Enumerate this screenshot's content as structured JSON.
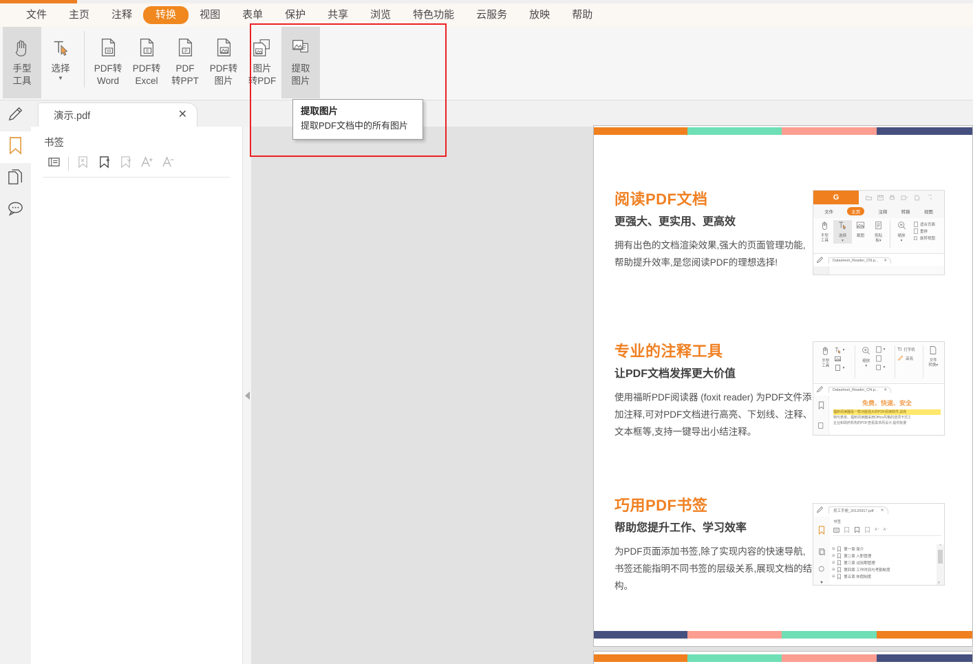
{
  "app": {
    "accent_orange": "#f0871f",
    "highlight_red": "#ec2024"
  },
  "menubar": {
    "items": [
      {
        "label": "文件",
        "active": false
      },
      {
        "label": "主页",
        "active": false
      },
      {
        "label": "注释",
        "active": false
      },
      {
        "label": "转换",
        "active": true
      },
      {
        "label": "视图",
        "active": false
      },
      {
        "label": "表单",
        "active": false
      },
      {
        "label": "保护",
        "active": false
      },
      {
        "label": "共享",
        "active": false
      },
      {
        "label": "浏览",
        "active": false
      },
      {
        "label": "特色功能",
        "active": false
      },
      {
        "label": "云服务",
        "active": false
      },
      {
        "label": "放映",
        "active": false
      },
      {
        "label": "帮助",
        "active": false
      }
    ]
  },
  "ribbon": {
    "buttons": [
      {
        "icon": "hand-tool-icon",
        "line1": "手型",
        "line2": "工具",
        "selected": true,
        "caret": false
      },
      {
        "icon": "select-text-icon",
        "line1": "选择",
        "line2": "",
        "selected": false,
        "caret": true
      },
      {
        "icon": "pdf-to-word-icon",
        "line1": "PDF转",
        "line2": "Word",
        "selected": false,
        "caret": false
      },
      {
        "icon": "pdf-to-excel-icon",
        "line1": "PDF转",
        "line2": "Excel",
        "selected": false,
        "caret": false
      },
      {
        "icon": "pdf-to-ppt-icon",
        "line1": "PDF",
        "line2": "转PPT",
        "selected": false,
        "caret": false
      },
      {
        "icon": "pdf-to-image-icon",
        "line1": "PDF转",
        "line2": "图片",
        "selected": false,
        "caret": false
      },
      {
        "icon": "image-to-pdf-icon",
        "line1": "图片",
        "line2": "转PDF",
        "selected": false,
        "caret": false
      },
      {
        "icon": "extract-image-icon",
        "line1": "提取",
        "line2": "图片",
        "selected": true,
        "caret": false
      }
    ]
  },
  "tooltip": {
    "title": "提取图片",
    "body": "提取PDF文档中的所有图片"
  },
  "rail": {
    "items": [
      {
        "icon": "pen-edit-icon",
        "active": false
      },
      {
        "icon": "bookmark-icon",
        "active": true
      },
      {
        "icon": "pages-icon",
        "active": false
      },
      {
        "icon": "comments-icon",
        "active": false
      }
    ]
  },
  "filetab": {
    "name": "演示.pdf",
    "close": "✕"
  },
  "bookmarks": {
    "title": "书签",
    "tools": [
      {
        "icon": "list-view-icon"
      },
      {
        "icon": "delete-bookmark-icon"
      },
      {
        "icon": "add-bookmark-icon"
      },
      {
        "icon": "bookmark-options-icon"
      },
      {
        "icon": "increase-font-icon"
      },
      {
        "icon": "decrease-font-icon"
      }
    ]
  },
  "page": {
    "topbar_colors": [
      "#f0801f",
      "#6fdfb5",
      "#fb9e91",
      "#46507e"
    ],
    "bottombar_colors": [
      "#46507e",
      "#fb9e91",
      "#6fdfb5",
      "#f0801f"
    ],
    "page2_topbar_colors": [
      "#f0801f",
      "#6fdfb5",
      "#fb9e91",
      "#46507e"
    ],
    "sections": [
      {
        "h1": "阅读PDF文档",
        "h2": "更强大、更实用、更高效",
        "p": "拥有出色的文档渲染效果,强大的页面管理功能,帮助提升效率,是您阅读PDF的理想选择!",
        "shot": "reader-home-ribbon-screenshot",
        "shot_data": {
          "tabs": [
            "文件",
            "主页",
            "注释",
            "转换",
            "视图"
          ],
          "active_tab": "主页",
          "tools": [
            "手型工具",
            "选择",
            "截图",
            "剪贴板"
          ],
          "zoom_label": "缩放",
          "right_items": [
            "适合页面",
            "重排",
            "旋转视图"
          ],
          "filetab": "Datasheet_Reader_CN.p..."
        }
      },
      {
        "h1": "专业的注释工具",
        "h2": "让PDF文档发挥更大价值",
        "p": "使用福昕PDF阅读器 (foxit reader) 为PDF文件添加注释,可对PDF文档进行高亮、下划线、注释、文本框等,支持一键导出小结注释。",
        "shot": "annotation-tools-screenshot",
        "shot_data": {
          "tools": [
            "手型工具",
            "缩放",
            "打字机",
            "高亮",
            "文件转换"
          ],
          "filetab": "Datasheet_Reader_CN.p...",
          "doc_heading": "免费、快速、安全",
          "doc_line1": "福昕阅读器是一款功能强大的PDF阅读软件,具有",
          "doc_line2": "档与表单。福昕阅读器采用Office风格的选项卡式工",
          "doc_line3": "企业和政府机构的PDF查看需求而设计,提供批量"
        }
      },
      {
        "h1": "巧用PDF书签",
        "h2": "帮助您提升工作、学习效率",
        "p": "为PDF页面添加书签,除了实现内容的快速导航,书签还能指明不同书签的层级关系,展现文档的结构。",
        "shot": "bookmarks-panel-screenshot",
        "shot_data": {
          "filetab": "员工手册_20120917.pdf",
          "panel_title": "书签",
          "entries": [
            "第一章  简介",
            "第二章  入职管理",
            "第三章  试用期管理",
            "第四章  工作时间与考勤制度",
            "第五章  休假制度"
          ]
        }
      }
    ]
  }
}
